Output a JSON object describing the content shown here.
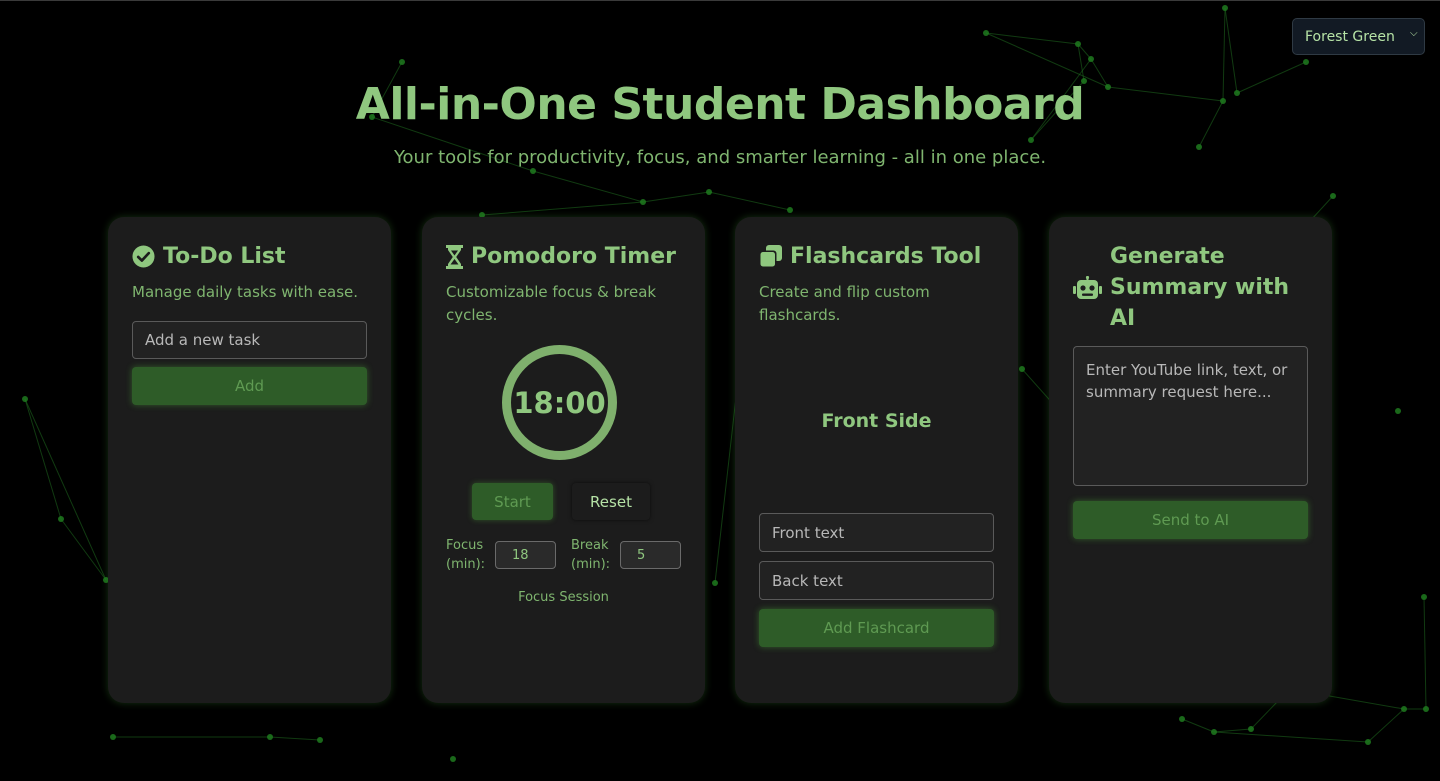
{
  "theme_selector": {
    "selected": "Forest Green"
  },
  "header": {
    "title": "All-in-One Student Dashboard",
    "subtitle": "Your tools for productivity, focus, and smarter learning - all in one place."
  },
  "todo": {
    "title": "To-Do List",
    "description": "Manage daily tasks with ease.",
    "input_placeholder": "Add a new task",
    "add_label": "Add",
    "icon": "check-circle-icon"
  },
  "pomodoro": {
    "title": "Pomodoro Timer",
    "description": "Customizable focus & break cycles.",
    "time_display": "18:00",
    "start_label": "Start",
    "reset_label": "Reset",
    "focus_label_1": "Focus",
    "focus_label_2": "(min):",
    "focus_value": "18",
    "break_label_1": "Break",
    "break_label_2": "(min):",
    "break_value": "5",
    "session_label": "Focus Session",
    "icon": "hourglass-icon"
  },
  "flashcards": {
    "title": "Flashcards Tool",
    "description": "Create and flip custom flashcards.",
    "card_face": "Front Side",
    "front_placeholder": "Front text",
    "back_placeholder": "Back text",
    "add_label": "Add Flashcard",
    "icon": "cards-stack-icon"
  },
  "ai_summary": {
    "title": "Generate Summary with AI",
    "textarea_placeholder": "Enter YouTube link, text, or summary request here...",
    "send_label": "Send to AI",
    "icon": "robot-icon"
  },
  "colors": {
    "background": "#000000",
    "card": "#1c1c1c",
    "accent_text": "#8fc77f",
    "button_green": "#2e5c28",
    "network_line": "#1f6b1f"
  }
}
